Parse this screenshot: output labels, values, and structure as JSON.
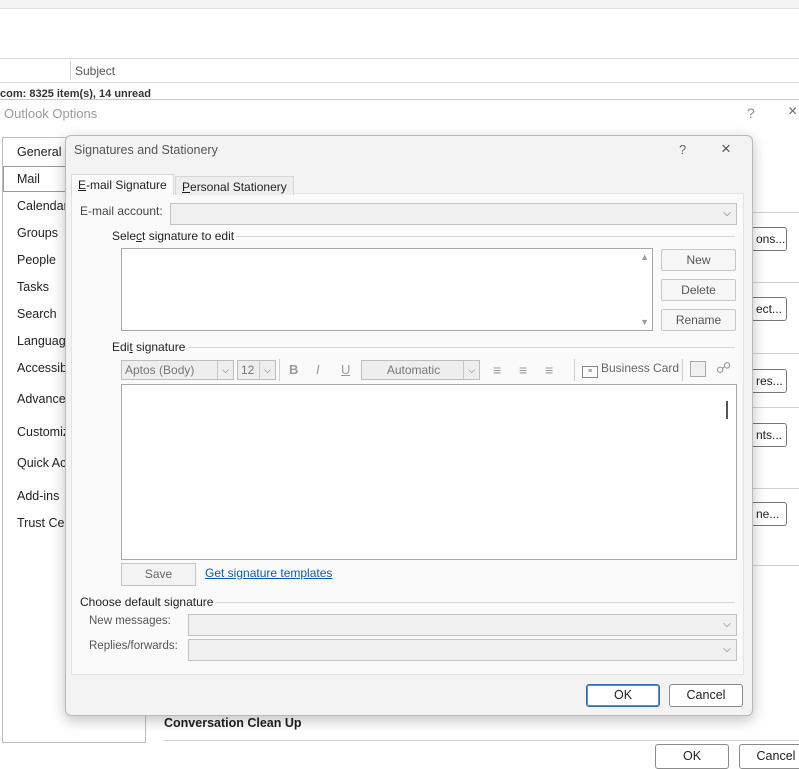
{
  "outlook": {
    "list_header_subject": "Subject",
    "status_text": "com: 8325 item(s), 14 unread"
  },
  "options": {
    "title": "Outlook Options",
    "help": "?",
    "close": "×",
    "nav": [
      "General",
      "Mail",
      "Calendar",
      "Groups",
      "People",
      "Tasks",
      "Search",
      "Language",
      "Accessibi",
      "Advanced",
      "Customiz",
      "Quick Ac",
      "Add-ins",
      "Trust Cen"
    ],
    "side_buttons": [
      "ons...",
      "ect...",
      "res...",
      "nts...",
      "ne..."
    ],
    "section_label": "Conversation Clean Up",
    "ok": "OK",
    "cancel": "Cancel"
  },
  "signatures": {
    "title": "Signatures and Stationery",
    "help": "?",
    "close": "×",
    "tabs": {
      "email_signature": {
        "accel": "E",
        "rest": "-mail Signature"
      },
      "personal_stationery": {
        "accel": "P",
        "rest": "ersonal Stationery"
      }
    },
    "email_account_label": "E-mail account:",
    "email_account_value": "",
    "select_label": {
      "before": "Sele",
      "accel": "c",
      "after": "t signature to edit"
    },
    "new": "New",
    "delete": "Delete",
    "rename": "Rename",
    "edit_label": {
      "before": "Edi",
      "accel": "t",
      "after": " signature"
    },
    "font_name": "Aptos (Body)",
    "font_size": "12",
    "bold": "B",
    "italic": "I",
    "underline": "U",
    "color": "Automatic",
    "business_card": "Business Card",
    "save": "Save",
    "templates_link": "Get signature templates",
    "default_group_label": "Choose default signature",
    "new_messages_label": "New messages:",
    "new_messages_value": "",
    "replies_label": "Replies/forwards:",
    "replies_value": "",
    "ok": "OK",
    "cancel": "Cancel"
  }
}
